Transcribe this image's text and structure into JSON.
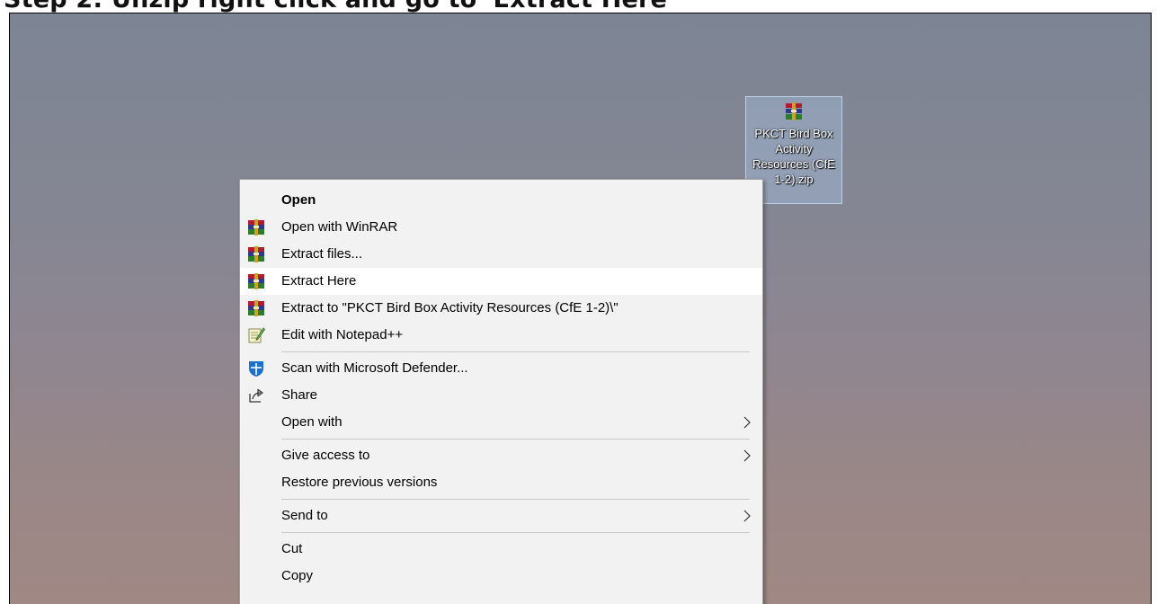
{
  "page_heading": "Step 2: Unzip right click and go to 'Extract Here'",
  "desktop": {
    "zip_file_label": "PKCT Bird Box Activity Resources (CfE 1-2).zip"
  },
  "context_menu": {
    "open": "Open",
    "open_with_winrar": "Open with WinRAR",
    "extract_files": "Extract files...",
    "extract_here": "Extract Here",
    "extract_to": "Extract to \"PKCT Bird Box Activity Resources (CfE 1-2)\\\"",
    "edit_with_notepad": "Edit with Notepad++",
    "scan_with_defender": "Scan with Microsoft Defender...",
    "share": "Share",
    "open_with": "Open with",
    "give_access_to": "Give access to",
    "restore_previous_versions": "Restore previous versions",
    "send_to": "Send to",
    "cut": "Cut",
    "copy": "Copy"
  },
  "highlighted_item": "Extract Here",
  "icons": {
    "winrar": "winrar-icon",
    "notepad": "notepad-plus-plus-icon",
    "defender": "microsoft-defender-icon",
    "share": "share-icon",
    "submenu": "chevron-right-icon"
  },
  "colors": {
    "menu_background": "#f2f2f2",
    "menu_highlight": "#ffffff",
    "desktop_top": "#7d8594",
    "desktop_bottom": "#a08884",
    "selection": "#aac8eb"
  }
}
